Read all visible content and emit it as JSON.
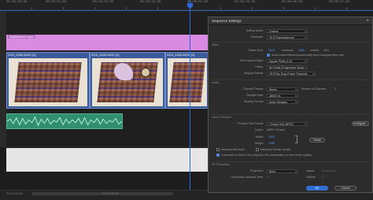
{
  "timeline": {
    "ruler_timecodes": [
      "00;00;00;00",
      "00;00;01;00",
      "00;00;02;00",
      "00;00;03;00",
      "00;00;04;00",
      "00;00;05;00",
      "00;00;06;00",
      "00;00;07;00"
    ],
    "adjustment_layer_label": "Adjustment Layer",
    "clips": [
      "SO3_0340.MOV [V]",
      "SO3_0340.MOV [V]",
      "SO3_0340.MOV [V]"
    ],
    "bottom_timecodes": [
      "00;00;00;00",
      "00;00;05;00"
    ]
  },
  "dialog": {
    "title": "Sequence Settings",
    "close_label": "×",
    "editing_mode_label": "Editing Mode:",
    "editing_mode_value": "Custom",
    "timebase_label": "Timebase:",
    "timebase_value": "29.97 frames/second",
    "video_section": "Video",
    "frame_size_label": "Frame Size:",
    "frame_width": "1920",
    "horizontal_label": "horizontal",
    "frame_height": "1080",
    "vertical_label": "vertical",
    "aspect_label": "16:9",
    "scale_checkbox_label": "Scale motion effects proportionally when changing frame size",
    "pixel_aspect_label": "Pixel Aspect Ratio:",
    "pixel_aspect_value": "Square Pixels (1.0)",
    "fields_label": "Fields:",
    "fields_value": "No Fields (Progressive Scan)",
    "display_format_label": "Display Format:",
    "display_format_value": "29.97 fps Drop-Frame Timecode",
    "audio_section": "Audio",
    "channel_format_label": "Channel Format:",
    "channel_format_value": "Stereo",
    "number_channels_label": "Number of Channels:",
    "number_channels_value": "2",
    "sample_rate_label": "Sample Rate:",
    "sample_rate_value": "48000 Hz",
    "audio_display_label": "Display Format:",
    "audio_display_value": "Audio Samples",
    "previews_section": "Video Previews",
    "preview_format_label": "Preview File Format:",
    "preview_format_value": "I-Frame Only MPEG",
    "configure_label": "Configure...",
    "codec_label": "Codec:",
    "codec_value": "MPEG I-Frame",
    "width_label": "Width:",
    "width_value": "1920",
    "height_label": "Height:",
    "height_value": "1080",
    "reset_label": "Reset",
    "max_bit_depth_label": "Maximum Bit Depth",
    "max_render_label": "Maximum Render Quality",
    "linear_color_label": "Composite in Linear Color (requires GPU acceleration or max render quality)",
    "vr_section": "VR Properties",
    "projection_label": "Projection:",
    "projection_value": "None",
    "layout_label": "Layout:",
    "layout_value": "Monoscopic",
    "h_fov_label": "Horizontal Captured View:",
    "h_fov_value": "0°",
    "v_label": "Vertical:",
    "v_value": "0°",
    "ok_label": "OK",
    "cancel_label": "Cancel"
  },
  "colors": {
    "adjustment_layer": "#d98be2",
    "video_clip": "#3b5a9a",
    "audio_clip": "#2f8f6f",
    "playhead": "#2b6ad8",
    "ok_button": "#2f6fd6"
  }
}
